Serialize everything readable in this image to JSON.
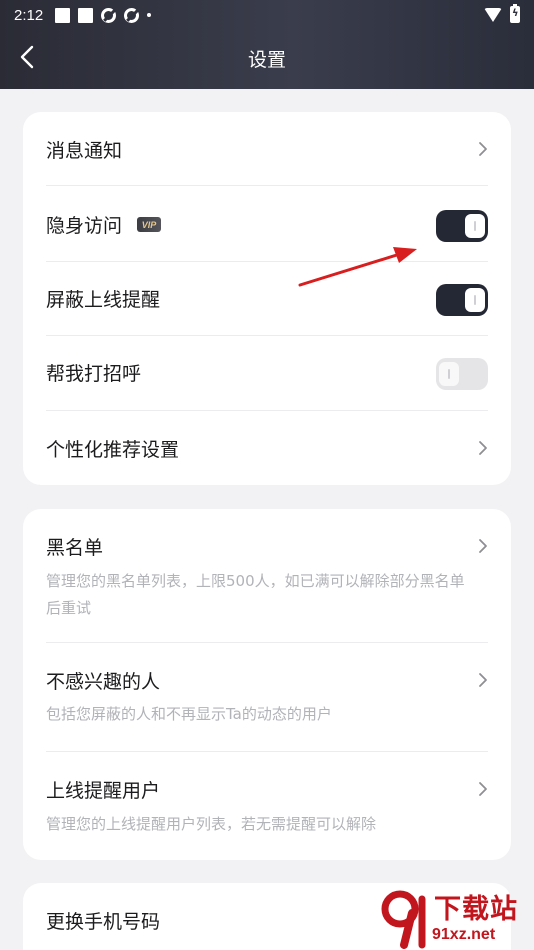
{
  "status_bar": {
    "time": "2:12"
  },
  "header": {
    "title": "设置"
  },
  "group1": {
    "items": [
      {
        "label": "消息通知",
        "control": "chevron"
      },
      {
        "label": "隐身访问",
        "badge": "VIP",
        "control": "toggle",
        "on": true
      },
      {
        "label": "屏蔽上线提醒",
        "control": "toggle",
        "on": true
      },
      {
        "label": "帮我打招呼",
        "control": "toggle",
        "on": false
      },
      {
        "label": "个性化推荐设置",
        "control": "chevron"
      }
    ]
  },
  "group2": {
    "items": [
      {
        "label": "黑名单",
        "desc": "管理您的黑名单列表，上限500人，如已满可以解除部分黑名单后重试"
      },
      {
        "label": "不感兴趣的人",
        "desc": "包括您屏蔽的人和不再显示Ta的动态的用户"
      },
      {
        "label": "上线提醒用户",
        "desc": "管理您的上线提醒用户列表，若无需提醒可以解除"
      }
    ]
  },
  "group3": {
    "items": [
      {
        "label": "更换手机号码"
      }
    ]
  },
  "watermark": {
    "title": "下载站",
    "url": "91xz.net"
  },
  "colors": {
    "header": "#2e303c",
    "toggle_on": "#242734",
    "toggle_off": "#e5e5e7",
    "annotation_arrow": "#d81e1e"
  }
}
